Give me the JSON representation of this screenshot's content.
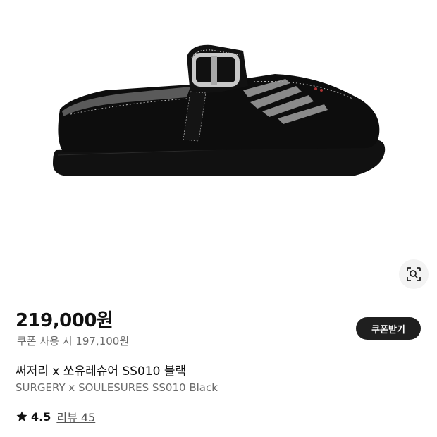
{
  "product": {
    "image_alt": "black suede slide shoe with silver buckle",
    "price": "219,000원",
    "coupon_price": "쿠폰 사용 시 197,100원",
    "coupon_button_label": "쿠폰받기",
    "name_ko": "써저리 x 쏘유레슈어 SS010 블랙",
    "name_en": "SURGERY x SOULESURES SS010 Black",
    "rating": "4.5",
    "review_label": "리뷰 45"
  },
  "icons": {
    "lens": "lens-search-icon",
    "star": "star-icon"
  },
  "colors": {
    "button_bg": "#1f1f1f",
    "secondary_text": "#6b6b6b",
    "lens_bg": "#f3f3f3"
  }
}
